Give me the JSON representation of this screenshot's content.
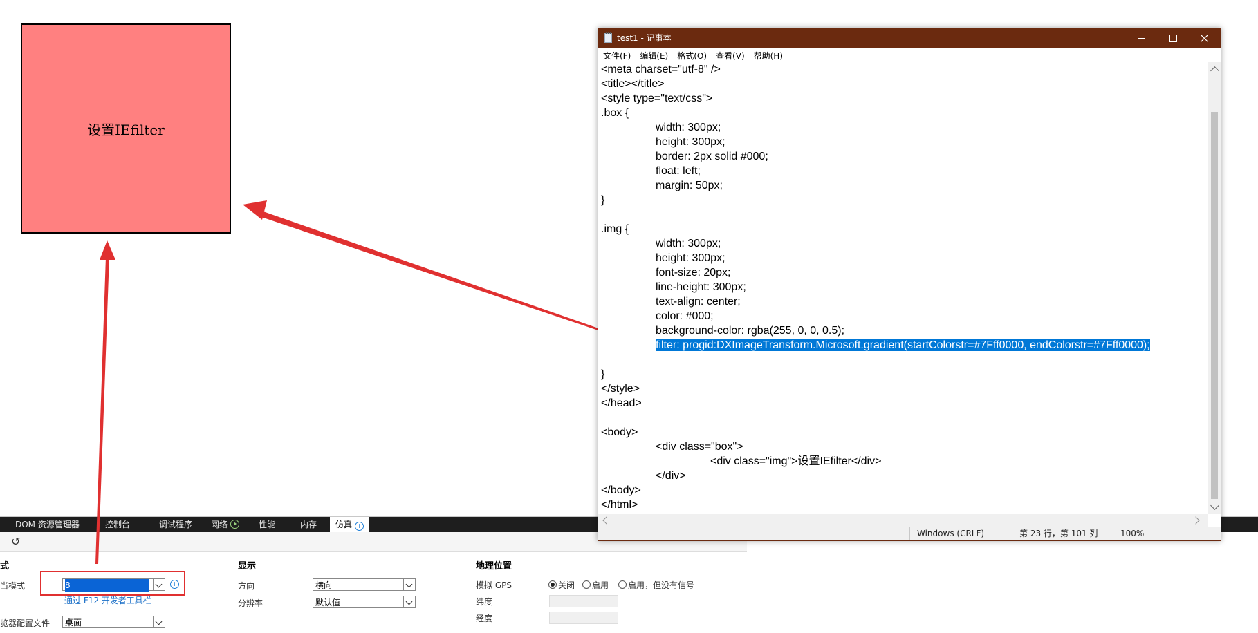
{
  "rendered_box": {
    "text": "设置IEfilter",
    "bg_color": "#ff8080"
  },
  "annotation_color": "#e03030",
  "devtools": {
    "tabs": [
      {
        "label": "DOM 资源管理器"
      },
      {
        "label": "控制台"
      },
      {
        "label": "调试程序"
      },
      {
        "label": "网络"
      },
      {
        "label": "性能"
      },
      {
        "label": "内存"
      },
      {
        "label": "仿真"
      }
    ],
    "mode_section": {
      "heading": "式",
      "doc_mode_label": "当模式",
      "doc_mode_value": "8",
      "f12_link": "通过 F12 开发者工具栏",
      "profile_label": "览器配置文件",
      "profile_value": "桌面"
    },
    "display_section": {
      "heading": "显示",
      "orientation_label": "方向",
      "orientation_value": "横向",
      "resolution_label": "分辨率",
      "resolution_value": "默认值"
    },
    "geo_section": {
      "heading": "地理位置",
      "gps_label": "模拟 GPS",
      "gps_options": [
        "关闭",
        "启用",
        "启用，但没有信号"
      ],
      "lat_label": "纬度",
      "lng_label": "经度"
    }
  },
  "notepad": {
    "title": "test1 - 记事本",
    "menu": [
      "文件(F)",
      "编辑(E)",
      "格式(O)",
      "查看(V)",
      "帮助(H)"
    ],
    "lines": [
      "<meta charset=\"utf-8\" />",
      "<title></title>",
      "<style type=\"text/css\">",
      ".box {",
      "width: 300px;",
      "height: 300px;",
      "border: 2px solid #000;",
      "float: left;",
      "margin: 50px;",
      "}",
      "",
      ".img {",
      "width: 300px;",
      "height: 300px;",
      "font-size: 20px;",
      "line-height: 300px;",
      "text-align: center;",
      "color: #000;",
      "background-color: rgba(255, 0, 0, 0.5);",
      "filter: progid:DXImageTransform.Microsoft.gradient(startColorstr=#7Fff0000, endColorstr=#7Fff0000);",
      "",
      "}",
      "</style>",
      "</head>",
      "",
      "<body>",
      "<div class=\"box\">",
      "<div class=\"img\">设置IEfilter</div>",
      "</div>",
      "</body>",
      "</html>"
    ],
    "status": {
      "encoding": "Windows (CRLF)",
      "position": "第 23 行，第 101 列",
      "zoom": "100%"
    },
    "title_bar_color": "#6b2a0f",
    "selection_color": "#0078d7"
  }
}
